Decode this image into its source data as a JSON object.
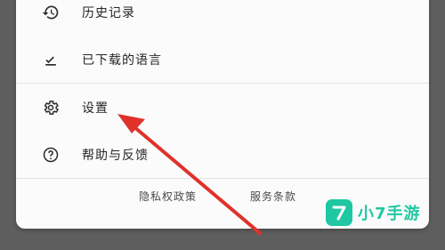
{
  "menu": {
    "items": [
      {
        "label": "历史记录",
        "icon": "history-icon"
      },
      {
        "label": "已下载的语言",
        "icon": "download-done-icon"
      },
      {
        "label": "设置",
        "icon": "gear-icon"
      },
      {
        "label": "帮助与反馈",
        "icon": "help-icon"
      }
    ]
  },
  "footer": {
    "privacy_label": "隐私权政策",
    "terms_label": "服务条款"
  },
  "annotation": {
    "color": "#e0322b"
  },
  "watermark": {
    "text": "小7手游",
    "logo_text": "7",
    "color": "#1fc7a3"
  },
  "colors": {
    "background": "#5e5e5e",
    "panel": "#fbfbfb",
    "text": "#262626"
  }
}
